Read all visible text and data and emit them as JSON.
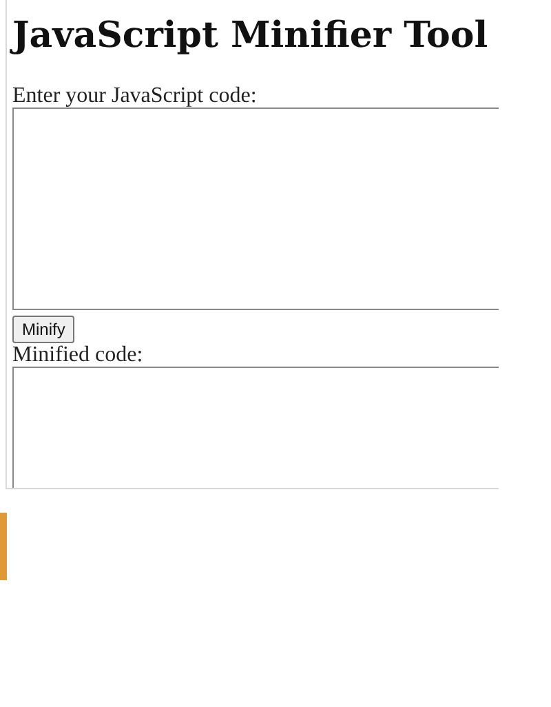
{
  "title": "JavaScript Minifier Tool",
  "input": {
    "label": "Enter your JavaScript code:"
  },
  "minify_button": {
    "label": "Minify"
  },
  "output": {
    "label": "Minified code:"
  }
}
